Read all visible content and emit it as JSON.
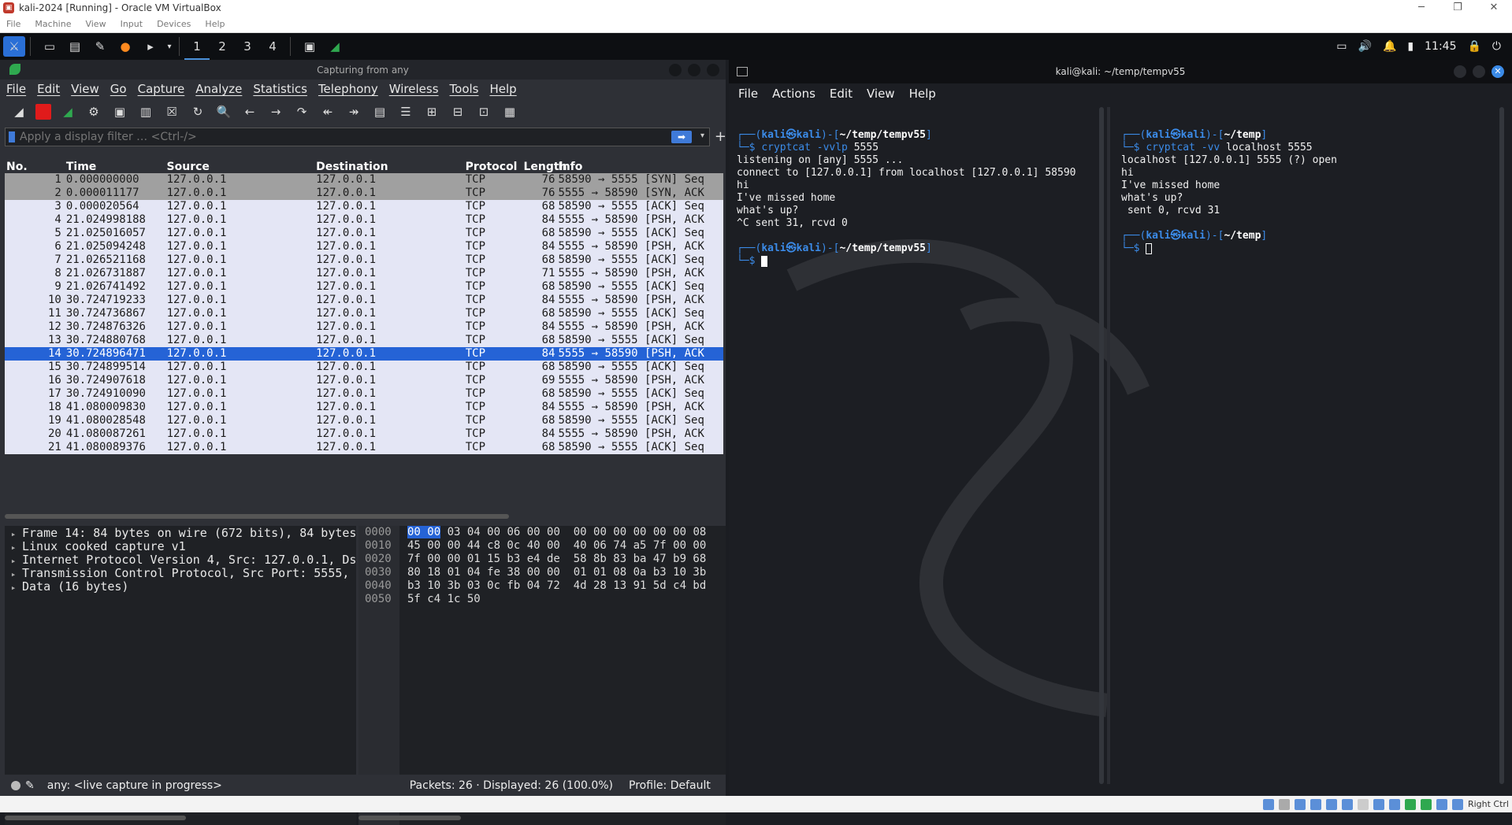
{
  "vbox": {
    "title": "kali-2024 [Running] - Oracle VM VirtualBox",
    "menu": [
      "File",
      "Machine",
      "View",
      "Input",
      "Devices",
      "Help"
    ],
    "host_key": "Right Ctrl"
  },
  "panel": {
    "workspaces": [
      "1",
      "2",
      "3",
      "4"
    ],
    "clock": "11:45"
  },
  "wireshark": {
    "title": "Capturing from any",
    "menu": [
      "File",
      "Edit",
      "View",
      "Go",
      "Capture",
      "Analyze",
      "Statistics",
      "Telephony",
      "Wireless",
      "Tools",
      "Help"
    ],
    "filter_placeholder": "Apply a display filter … <Ctrl-/>",
    "columns": [
      "No.",
      "Time",
      "Source",
      "Destination",
      "Protocol",
      "Length",
      "Info"
    ],
    "packets": [
      {
        "no": "1",
        "time": "0.000000000",
        "src": "127.0.0.1",
        "dst": "127.0.0.1",
        "proto": "TCP",
        "len": "76",
        "info": "58590 → 5555 [SYN] Seq"
      },
      {
        "no": "2",
        "time": "0.000011177",
        "src": "127.0.0.1",
        "dst": "127.0.0.1",
        "proto": "TCP",
        "len": "76",
        "info": "5555 → 58590 [SYN, ACK"
      },
      {
        "no": "3",
        "time": "0.000020564",
        "src": "127.0.0.1",
        "dst": "127.0.0.1",
        "proto": "TCP",
        "len": "68",
        "info": "58590 → 5555 [ACK] Seq"
      },
      {
        "no": "4",
        "time": "21.024998188",
        "src": "127.0.0.1",
        "dst": "127.0.0.1",
        "proto": "TCP",
        "len": "84",
        "info": "5555 → 58590 [PSH, ACK"
      },
      {
        "no": "5",
        "time": "21.025016057",
        "src": "127.0.0.1",
        "dst": "127.0.0.1",
        "proto": "TCP",
        "len": "68",
        "info": "58590 → 5555 [ACK] Seq"
      },
      {
        "no": "6",
        "time": "21.025094248",
        "src": "127.0.0.1",
        "dst": "127.0.0.1",
        "proto": "TCP",
        "len": "84",
        "info": "5555 → 58590 [PSH, ACK"
      },
      {
        "no": "7",
        "time": "21.026521168",
        "src": "127.0.0.1",
        "dst": "127.0.0.1",
        "proto": "TCP",
        "len": "68",
        "info": "58590 → 5555 [ACK] Seq"
      },
      {
        "no": "8",
        "time": "21.026731887",
        "src": "127.0.0.1",
        "dst": "127.0.0.1",
        "proto": "TCP",
        "len": "71",
        "info": "5555 → 58590 [PSH, ACK"
      },
      {
        "no": "9",
        "time": "21.026741492",
        "src": "127.0.0.1",
        "dst": "127.0.0.1",
        "proto": "TCP",
        "len": "68",
        "info": "58590 → 5555 [ACK] Seq"
      },
      {
        "no": "10",
        "time": "30.724719233",
        "src": "127.0.0.1",
        "dst": "127.0.0.1",
        "proto": "TCP",
        "len": "84",
        "info": "5555 → 58590 [PSH, ACK"
      },
      {
        "no": "11",
        "time": "30.724736867",
        "src": "127.0.0.1",
        "dst": "127.0.0.1",
        "proto": "TCP",
        "len": "68",
        "info": "58590 → 5555 [ACK] Seq"
      },
      {
        "no": "12",
        "time": "30.724876326",
        "src": "127.0.0.1",
        "dst": "127.0.0.1",
        "proto": "TCP",
        "len": "84",
        "info": "5555 → 58590 [PSH, ACK"
      },
      {
        "no": "13",
        "time": "30.724880768",
        "src": "127.0.0.1",
        "dst": "127.0.0.1",
        "proto": "TCP",
        "len": "68",
        "info": "58590 → 5555 [ACK] Seq"
      },
      {
        "no": "14",
        "time": "30.724896471",
        "src": "127.0.0.1",
        "dst": "127.0.0.1",
        "proto": "TCP",
        "len": "84",
        "info": "5555 → 58590 [PSH, ACK"
      },
      {
        "no": "15",
        "time": "30.724899514",
        "src": "127.0.0.1",
        "dst": "127.0.0.1",
        "proto": "TCP",
        "len": "68",
        "info": "58590 → 5555 [ACK] Seq"
      },
      {
        "no": "16",
        "time": "30.724907618",
        "src": "127.0.0.1",
        "dst": "127.0.0.1",
        "proto": "TCP",
        "len": "69",
        "info": "5555 → 58590 [PSH, ACK"
      },
      {
        "no": "17",
        "time": "30.724910090",
        "src": "127.0.0.1",
        "dst": "127.0.0.1",
        "proto": "TCP",
        "len": "68",
        "info": "58590 → 5555 [ACK] Seq"
      },
      {
        "no": "18",
        "time": "41.080009830",
        "src": "127.0.0.1",
        "dst": "127.0.0.1",
        "proto": "TCP",
        "len": "84",
        "info": "5555 → 58590 [PSH, ACK"
      },
      {
        "no": "19",
        "time": "41.080028548",
        "src": "127.0.0.1",
        "dst": "127.0.0.1",
        "proto": "TCP",
        "len": "68",
        "info": "58590 → 5555 [ACK] Seq"
      },
      {
        "no": "20",
        "time": "41.080087261",
        "src": "127.0.0.1",
        "dst": "127.0.0.1",
        "proto": "TCP",
        "len": "84",
        "info": "5555 → 58590 [PSH, ACK"
      },
      {
        "no": "21",
        "time": "41.080089376",
        "src": "127.0.0.1",
        "dst": "127.0.0.1",
        "proto": "TCP",
        "len": "68",
        "info": "58590 → 5555 [ACK] Seq"
      }
    ],
    "selected_packet": "14",
    "details": [
      "Frame 14: 84 bytes on wire (672 bits), 84 bytes",
      "Linux cooked capture v1",
      "Internet Protocol Version 4, Src: 127.0.0.1, Ds",
      "Transmission Control Protocol, Src Port: 5555,",
      "Data (16 bytes)"
    ],
    "hex_offsets": [
      "0000",
      "0010",
      "0020",
      "0030",
      "0040",
      "0050"
    ],
    "hex_first": "00 00",
    "hex_lines": [
      " 03 04 00 06 00 00  00 00 00 00 00 00 08",
      "45 00 00 44 c8 0c 40 00  40 06 74 a5 7f 00 00",
      "7f 00 00 01 15 b3 e4 de  58 8b 83 ba 47 b9 68",
      "80 18 01 04 fe 38 00 00  01 01 08 0a b3 10 3b",
      "b3 10 3b 03 0c fb 04 72  4d 28 13 91 5d c4 bd",
      "5f c4 1c 50"
    ],
    "status_capture": "any: <live capture in progress>",
    "status_packets": "Packets: 26 · Displayed: 26 (100.0%)",
    "status_profile": "Profile: Default"
  },
  "terminal": {
    "title": "kali@kali: ~/temp/tempv55",
    "menu": [
      "File",
      "Actions",
      "Edit",
      "View",
      "Help"
    ],
    "left": {
      "path": "~/temp/tempv55",
      "command": "cryptcat -vvlp",
      "command_arg": " 5555",
      "output": [
        "listening on [any] 5555 ...",
        "connect to [127.0.0.1] from localhost [127.0.0.1] 58590",
        "hi",
        "I've missed home",
        "what's up?",
        "^C sent 31, rcvd 0"
      ],
      "path2": "~/temp/tempv55"
    },
    "right": {
      "path": "~/temp",
      "command": "cryptcat -vv",
      "command_arg": " localhost 5555",
      "output": [
        "localhost [127.0.0.1] 5555 (?) open",
        "hi",
        "I've missed home",
        "what's up?",
        " sent 0, rcvd 31"
      ],
      "path2": "~/temp"
    },
    "prompt_user": "kali",
    "prompt_host": "kali"
  }
}
